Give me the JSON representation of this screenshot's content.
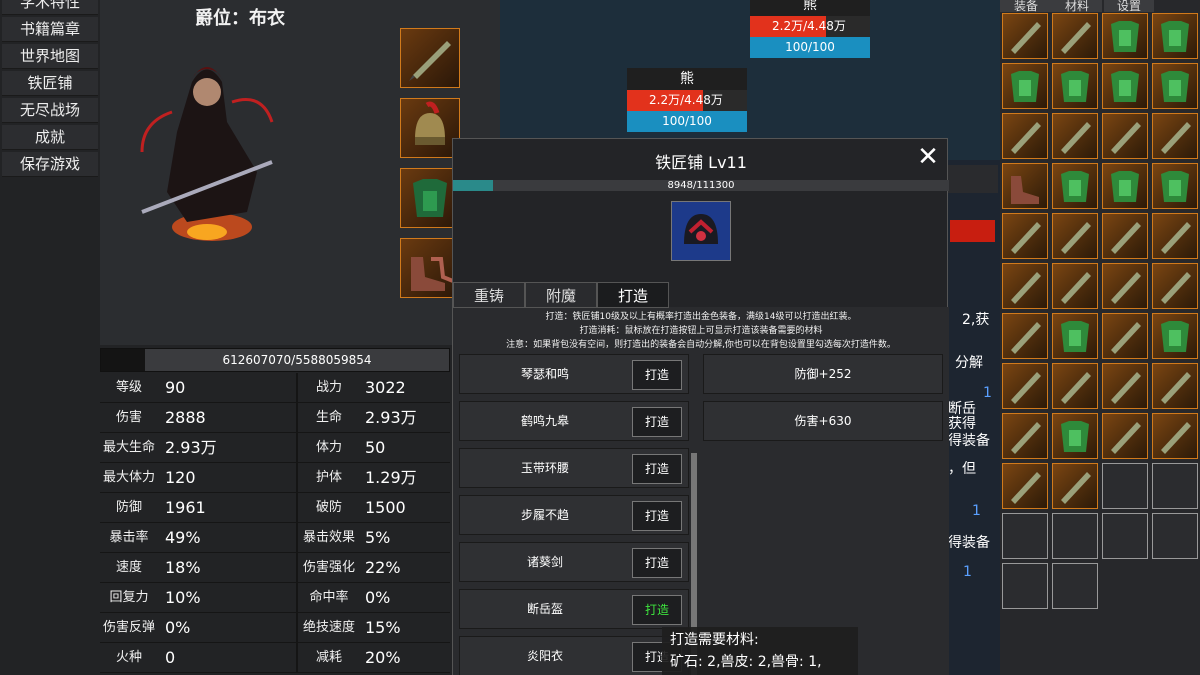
{
  "menu": [
    "学术特性",
    "书籍篇章",
    "世界地图",
    "铁匠铺",
    "无尽战场",
    "成就",
    "保存游戏"
  ],
  "hero": {
    "title": "爵位：布衣",
    "exp_text": "612607070/5588059854",
    "equip_slots": [
      "weapon-sword-icon",
      "helmet-icon",
      "armor-icon",
      "boots-icon"
    ]
  },
  "stats": [
    {
      "l1": "等级",
      "v1": "90",
      "l2": "战力",
      "v2": "3022"
    },
    {
      "l1": "伤害",
      "v1": "2888",
      "l2": "生命",
      "v2": "2.93万"
    },
    {
      "l1": "最大生命",
      "v1": "2.93万",
      "l2": "体力",
      "v2": "50"
    },
    {
      "l1": "最大体力",
      "v1": "120",
      "l2": "护体",
      "v2": "1.29万"
    },
    {
      "l1": "防御",
      "v1": "1961",
      "l2": "破防",
      "v2": "1500"
    },
    {
      "l1": "暴击率",
      "v1": "49%",
      "l2": "暴击效果",
      "v2": "5%"
    },
    {
      "l1": "速度",
      "v1": "18%",
      "l2": "伤害强化",
      "v2": "22%"
    },
    {
      "l1": "回复力",
      "v1": "10%",
      "l2": "命中率",
      "v2": "0%"
    },
    {
      "l1": "伤害反弹",
      "v1": "0%",
      "l2": "绝技速度",
      "v2": "15%"
    },
    {
      "l1": "火种",
      "v1": "0",
      "l2": "减耗",
      "v2": "20%"
    }
  ],
  "enemies": [
    {
      "name": "熊",
      "hp": "2.2万/4.48万",
      "mp": "100/100"
    },
    {
      "name": "熊",
      "hp": "2.2万/4.48万",
      "mp": "100/100"
    }
  ],
  "inventory": {
    "tabs": [
      "装备",
      "材料",
      "设置"
    ],
    "items": [
      "weapon",
      "weapon",
      "armor",
      "armor",
      "armor",
      "armor",
      "armor",
      "armor",
      "weapon",
      "weapon",
      "weapon",
      "weapon",
      "boots",
      "armor",
      "armor",
      "armor",
      "weapon",
      "weapon",
      "weapon",
      "weapon",
      "weapon",
      "weapon",
      "weapon",
      "weapon",
      "weapon",
      "armor",
      "weapon",
      "armor",
      "weapon",
      "weapon",
      "weapon",
      "weapon",
      "weapon",
      "armor",
      "weapon",
      "weapon",
      "weapon",
      "weapon",
      "empty",
      "empty",
      "empty",
      "empty",
      "empty",
      "empty",
      "empty",
      "empty"
    ]
  },
  "smith": {
    "title": "铁匠铺 Lv11",
    "close": "✕",
    "exp": "8948/111300",
    "exp_fraction": 0.08,
    "tabs": [
      "重铸",
      "附魔",
      "打造"
    ],
    "notes": [
      "打造：铁匠铺10级及以上有概率打造出金色装备，满级14级可以打造出红装。",
      "打造消耗：鼠标放在打造按钮上可显示打造该装备需要的材料",
      "注意：如果背包没有空间，则打造出的装备会自动分解,你也可以在背包设置里勾选每次打造件数。"
    ],
    "recipes": [
      {
        "name": "琴瑟和鸣",
        "btn": "打造"
      },
      {
        "name": "鹤鸣九皋",
        "btn": "打造"
      },
      {
        "name": "玉带环腰",
        "btn": "打造"
      },
      {
        "name": "步履不趋",
        "btn": "打造"
      },
      {
        "name": "诸葵剑",
        "btn": "打造"
      },
      {
        "name": "断岳盔",
        "btn": "打造"
      },
      {
        "name": "炎阳衣",
        "btn": "打造"
      }
    ],
    "attrs": [
      "防御+252",
      "伤害+630"
    ]
  },
  "tooltip": {
    "line1": "打造需要材料:",
    "line2": "矿石: 2,兽皮: 2,兽骨: 1,"
  },
  "bg_fragments": [
    "2,获",
    "分解",
    "1",
    "断岳",
    "获得",
    "得装备",
    "，但",
    "1",
    "得装备",
    "1"
  ]
}
